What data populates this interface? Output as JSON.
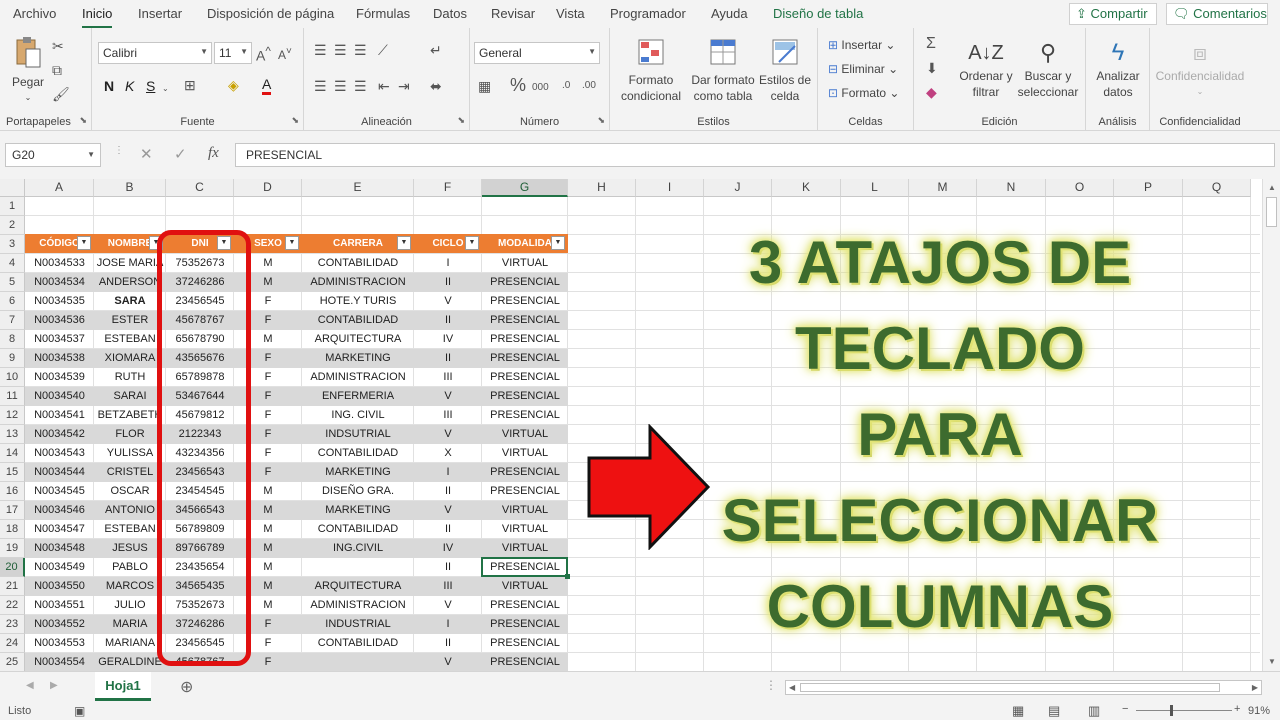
{
  "menu": {
    "items": [
      "Archivo",
      "Inicio",
      "Insertar",
      "Disposición de página",
      "Fórmulas",
      "Datos",
      "Revisar",
      "Vista",
      "Programador",
      "Ayuda",
      "Diseño de tabla"
    ],
    "active": "Inicio",
    "share_label": "Compartir",
    "comments_label": "Comentarios",
    "accent_color": "#217346"
  },
  "ribbon": {
    "clipboard": {
      "paste_label": "Pegar",
      "group_label": "Portapapeles"
    },
    "font": {
      "font_name": "Calibri",
      "font_size": "11",
      "bold": "N",
      "italic": "K",
      "underline": "S",
      "group_label": "Fuente"
    },
    "alignment": {
      "group_label": "Alineación"
    },
    "number": {
      "format": "General",
      "group_label": "Número"
    },
    "styles": {
      "conditional_label": "Formato\ncondicional",
      "table_label": "Dar formato\ncomo tabla",
      "cell_styles_label": "Estilos de\ncelda",
      "group_label": "Estilos"
    },
    "cells": {
      "insert_label": "Insertar",
      "delete_label": "Eliminar",
      "format_label": "Formato",
      "group_label": "Celdas"
    },
    "editing": {
      "sort_label": "Ordenar y\nfiltrar",
      "find_label": "Buscar y\nseleccionar",
      "group_label": "Edición"
    },
    "analysis": {
      "analyze_label": "Analizar\ndatos",
      "group_label": "Análisis"
    },
    "confidential": {
      "label": "Confidencialidad",
      "group_label": "Confidencialidad"
    }
  },
  "formula_bar": {
    "name_box": "G20",
    "fx": "fx",
    "value": "PRESENCIAL"
  },
  "grid": {
    "columns": [
      "A",
      "B",
      "C",
      "D",
      "E",
      "F",
      "G",
      "H",
      "I",
      "J",
      "K",
      "L",
      "M",
      "N",
      "O",
      "P",
      "Q"
    ],
    "selected_column": "G",
    "selected_row": "20",
    "header_color": "#ed7d31",
    "band_color": "#d9d9d9"
  },
  "table": {
    "headers": [
      "CÓDIGO",
      "NOMBRE",
      "DNI",
      "SEXO",
      "CARRERA",
      "CICLO",
      "MODALIDA"
    ],
    "rows": [
      [
        "N0034533",
        "JOSE MARIA",
        "75352673",
        "M",
        "CONTABILIDAD",
        "I",
        "VIRTUAL"
      ],
      [
        "N0034534",
        "ANDERSON",
        "37246286",
        "M",
        "ADMINISTRACION",
        "II",
        "PRESENCIAL"
      ],
      [
        "N0034535",
        "SARA",
        "23456545",
        "F",
        "HOTE.Y TURIS",
        "V",
        "PRESENCIAL"
      ],
      [
        "N0034536",
        "ESTER",
        "45678767",
        "F",
        "CONTABILIDAD",
        "II",
        "PRESENCIAL"
      ],
      [
        "N0034537",
        "ESTEBAN",
        "65678790",
        "M",
        "ARQUITECTURA",
        "IV",
        "PRESENCIAL"
      ],
      [
        "N0034538",
        "XIOMARA",
        "43565676",
        "F",
        "MARKETING",
        "II",
        "PRESENCIAL"
      ],
      [
        "N0034539",
        "RUTH",
        "65789878",
        "F",
        "ADMINISTRACION",
        "III",
        "PRESENCIAL"
      ],
      [
        "N0034540",
        "SARAI",
        "53467644",
        "F",
        "ENFERMERIA",
        "V",
        "PRESENCIAL"
      ],
      [
        "N0034541",
        "BETZABETH",
        "45679812",
        "F",
        "ING. CIVIL",
        "III",
        "PRESENCIAL"
      ],
      [
        "N0034542",
        "FLOR",
        "2122343",
        "F",
        "INDSUTRIAL",
        "V",
        "VIRTUAL"
      ],
      [
        "N0034543",
        "YULISSA",
        "43234356",
        "F",
        "CONTABILIDAD",
        "X",
        "VIRTUAL"
      ],
      [
        "N0034544",
        "CRISTEL",
        "23456543",
        "F",
        "MARKETING",
        "I",
        "PRESENCIAL"
      ],
      [
        "N0034545",
        "OSCAR",
        "23454545",
        "M",
        "DISEÑO GRA.",
        "II",
        "PRESENCIAL"
      ],
      [
        "N0034546",
        "ANTONIO",
        "34566543",
        "M",
        "MARKETING",
        "V",
        "VIRTUAL"
      ],
      [
        "N0034547",
        "ESTEBAN",
        "56789809",
        "M",
        "CONTABILIDAD",
        "II",
        "VIRTUAL"
      ],
      [
        "N0034548",
        "JESUS",
        "89766789",
        "M",
        "ING.CIVIL",
        "IV",
        "VIRTUAL"
      ],
      [
        "N0034549",
        "PABLO",
        "23435654",
        "M",
        "",
        "II",
        "PRESENCIAL"
      ],
      [
        "N0034550",
        "MARCOS",
        "34565435",
        "M",
        "ARQUITECTURA",
        "III",
        "VIRTUAL"
      ],
      [
        "N0034551",
        "JULIO",
        "75352673",
        "M",
        "ADMINISTRACION",
        "V",
        "PRESENCIAL"
      ],
      [
        "N0034552",
        "MARIA",
        "37246286",
        "F",
        "INDUSTRIAL",
        "I",
        "PRESENCIAL"
      ],
      [
        "N0034553",
        "MARIANA",
        "23456545",
        "F",
        "CONTABILIDAD",
        "II",
        "PRESENCIAL"
      ],
      [
        "N0034554",
        "GERALDINE",
        "45678767",
        "F",
        "",
        "V",
        "PRESENCIAL"
      ]
    ]
  },
  "overlay": {
    "lines": [
      "3 ATAJOS DE",
      "TECLADO",
      "PARA",
      "SELECCIONAR",
      "COLUMNAS"
    ],
    "highlight_color": "#e01010",
    "text_color": "#3d6b2e"
  },
  "sheets": {
    "active": "Hoja1",
    "tabs": [
      "Hoja1"
    ]
  },
  "status": {
    "ready": "Listo",
    "zoom": "91%"
  }
}
